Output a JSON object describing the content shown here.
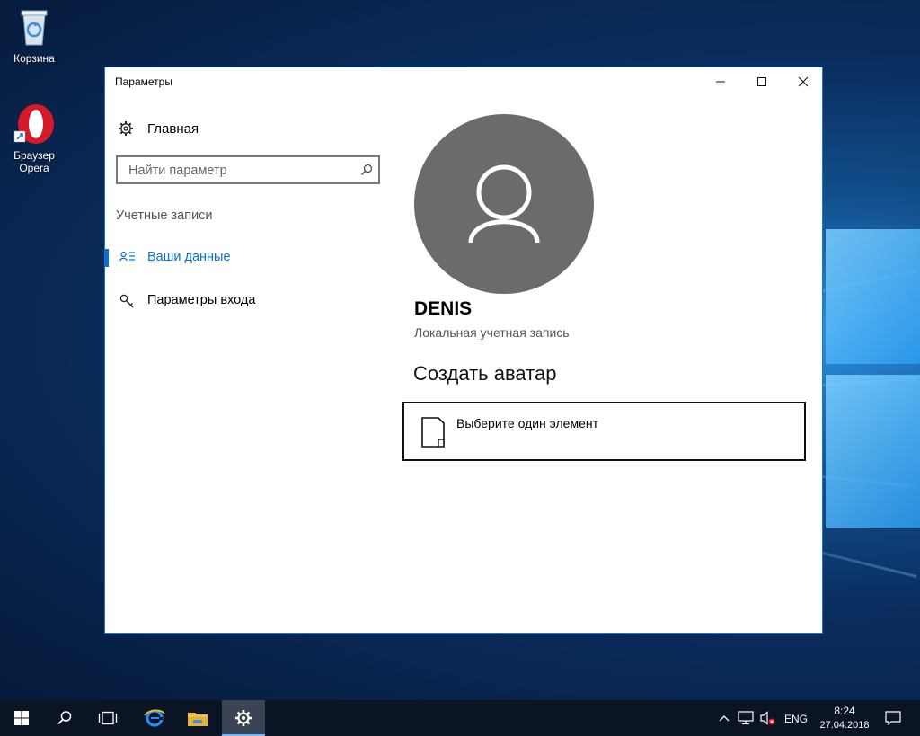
{
  "desktop": {
    "icons": [
      {
        "label": "Корзина",
        "icon": "recycle-bin-icon"
      },
      {
        "label_line1": "Браузер",
        "label_line2": "Opera",
        "icon": "opera-icon"
      }
    ]
  },
  "window": {
    "title": "Параметры",
    "controls": [
      "minimize",
      "maximize",
      "close"
    ],
    "accent_color": "#0a6fd0"
  },
  "sidebar": {
    "home_label": "Главная",
    "search_placeholder": "Найти параметр",
    "section_header": "Учетные записи",
    "items": [
      {
        "label": "Ваши данные",
        "icon": "person-list-icon",
        "selected": true
      },
      {
        "label": "Параметры входа",
        "icon": "key-icon",
        "selected": false
      }
    ]
  },
  "main": {
    "user_name": "DENIS",
    "account_type": "Локальная учетная запись",
    "create_avatar_heading": "Создать аватар",
    "browse_button_label": "Выберите один элемент"
  },
  "taskbar": {
    "language": "ENG",
    "time": "8:24",
    "date": "27.04.2018",
    "pinned": [
      "start-icon",
      "search-icon",
      "task-view-icon",
      "edge-icon",
      "file-explorer-icon",
      "settings-icon"
    ]
  }
}
